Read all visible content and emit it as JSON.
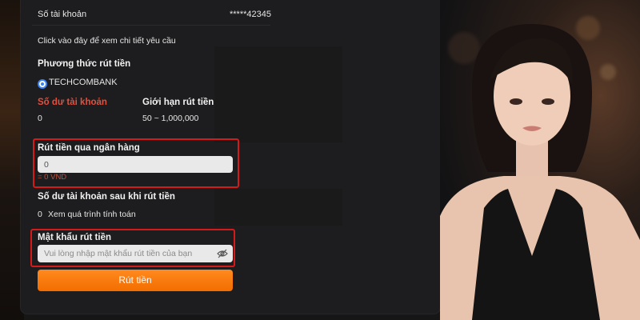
{
  "account": {
    "label": "Số tài khoản",
    "value": "*****42345"
  },
  "details_link": "Click vào đây để xem chi tiết yêu cầu",
  "method": {
    "title": "Phương thức rút tiền",
    "selected": "TECHCOMBANK"
  },
  "balance": {
    "label": "Số dư tài khoản",
    "value": "0"
  },
  "limit": {
    "label": "Giới hạn rút tiền",
    "value": "50 ~ 1,000,000"
  },
  "withdraw": {
    "label": "Rút tiền qua ngân hàng",
    "input_value": "0",
    "converted": "= 0 VND"
  },
  "after_balance": {
    "label": "Số dư tài khoản sau khi rút tiền",
    "value": "0",
    "link": "Xem quá trình tính toán"
  },
  "password": {
    "label": "Mật khẩu rút tiền",
    "placeholder": "Vui lòng nhập mật khẩu rút tiền của bạn"
  },
  "submit_label": "Rút tiền",
  "colors": {
    "accent": "#f36d00",
    "highlight": "#d61a1a",
    "radio": "#3b82f6",
    "warning_text": "#e0503f"
  },
  "icons": [
    "eye-off-icon",
    "radio-selected-icon"
  ]
}
